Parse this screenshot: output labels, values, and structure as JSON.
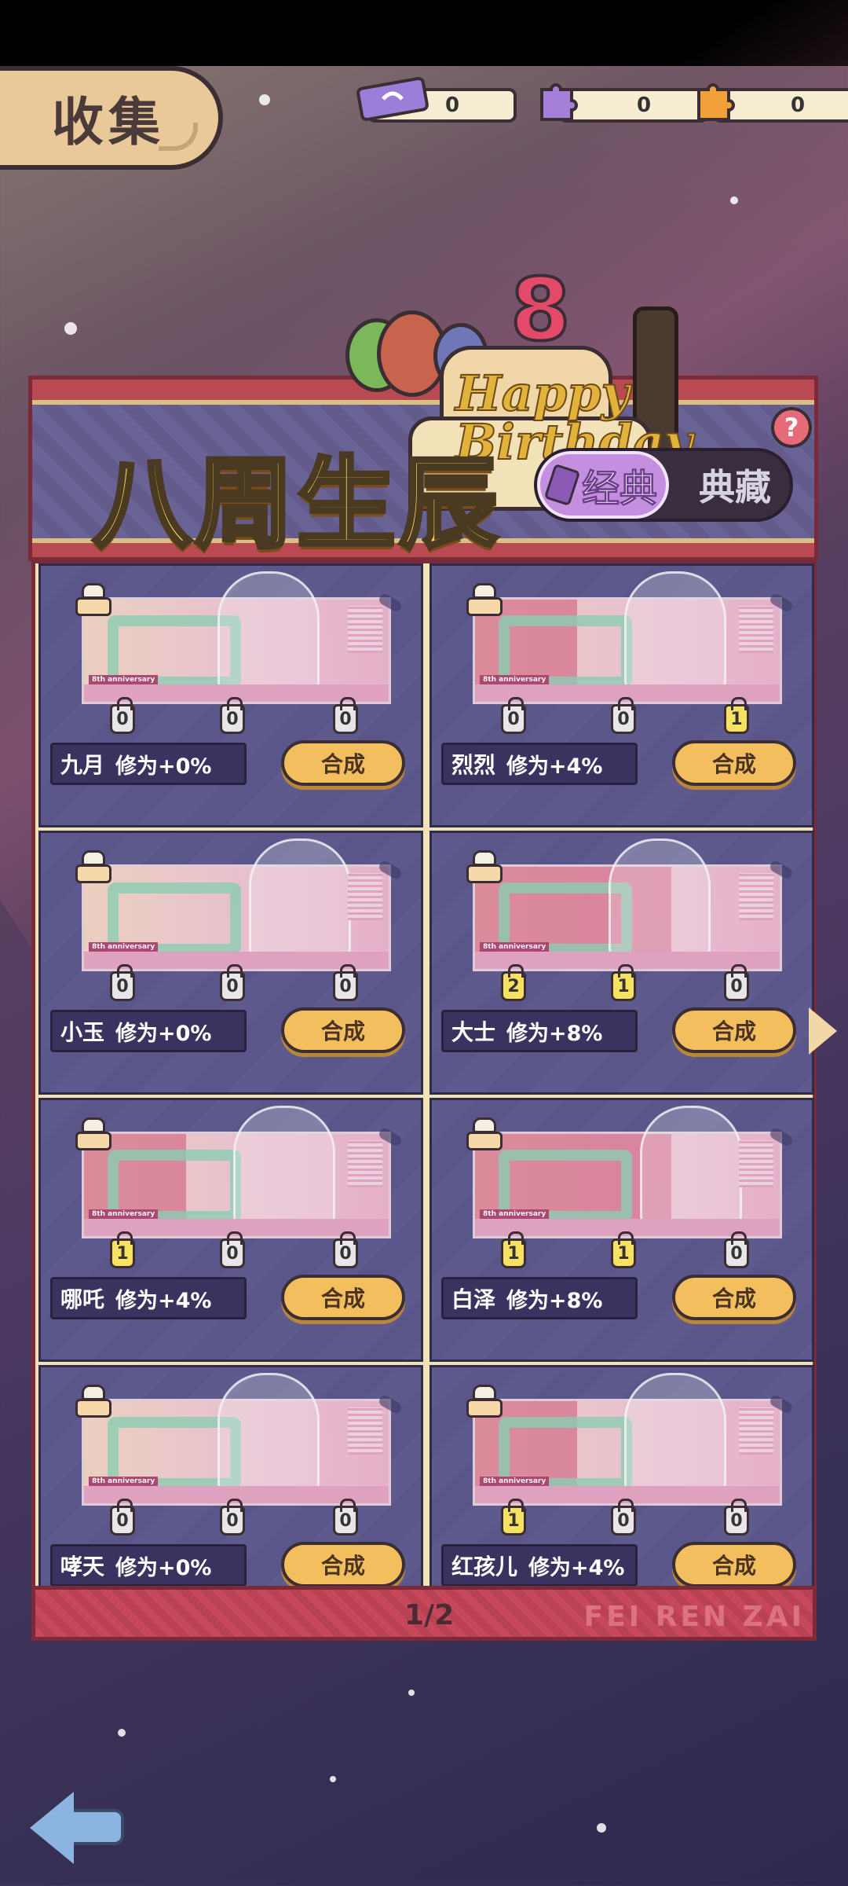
{
  "title_tab": "收集",
  "currencies": [
    {
      "icon": "ticket-currency-icon",
      "value": "0",
      "color": "#9b7ed8"
    },
    {
      "icon": "purple-puzzle-currency-icon",
      "value": "0",
      "color": "#a57fd8"
    },
    {
      "icon": "orange-puzzle-currency-icon",
      "value": "0",
      "color": "#f2a13a"
    }
  ],
  "banner": {
    "title": "八周生辰",
    "cake_number": "8",
    "cake_text": "Happy Birthday",
    "tab_classic": "经典",
    "tab_collection": "典藏"
  },
  "anniversary_label": "8th anniversary",
  "cards": [
    {
      "name": "九月",
      "bonus": "修为+0%",
      "pieces": [
        "0",
        "0",
        "0"
      ],
      "button": "合成",
      "lit": 0
    },
    {
      "name": "烈烈",
      "bonus": "修为+4%",
      "pieces": [
        "0",
        "0",
        "1"
      ],
      "button": "合成",
      "lit": 1
    },
    {
      "name": "小玉",
      "bonus": "修为+0%",
      "pieces": [
        "0",
        "0",
        "0"
      ],
      "button": "合成",
      "lit": 0
    },
    {
      "name": "大士",
      "bonus": "修为+8%",
      "pieces": [
        "2",
        "1",
        "0"
      ],
      "button": "合成",
      "lit": 2
    },
    {
      "name": "哪吒",
      "bonus": "修为+4%",
      "pieces": [
        "1",
        "0",
        "0"
      ],
      "button": "合成",
      "lit": 1
    },
    {
      "name": "白泽",
      "bonus": "修为+8%",
      "pieces": [
        "1",
        "1",
        "0"
      ],
      "button": "合成",
      "lit": 2
    },
    {
      "name": "哮天",
      "bonus": "修为+0%",
      "pieces": [
        "0",
        "0",
        "0"
      ],
      "button": "合成",
      "lit": 0
    },
    {
      "name": "红孩儿",
      "bonus": "修为+4%",
      "pieces": [
        "1",
        "0",
        "0"
      ],
      "button": "合成",
      "lit": 1
    }
  ],
  "pager": {
    "text": "1/2"
  },
  "watermark": "FEI REN ZAI",
  "colors": {
    "accent_gold": "#f6cd4e",
    "button": "#f2be5e",
    "card_bg": "#5e5a8e",
    "frame_red": "#b94a52"
  }
}
